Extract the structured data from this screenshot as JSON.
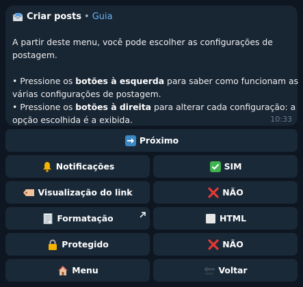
{
  "header": {
    "title": "Criar posts",
    "separator": "•",
    "subtitle": "Guia",
    "icon": "envelope-icon"
  },
  "message": {
    "line1": "A partir deste menu, você pode escolher as configurações de",
    "line2": "postagem.",
    "b1_prefix": "• Pressione os ",
    "b1_bold": "botões à esquerda",
    "b1_suffix": " para saber como funcionam as",
    "b1_line2": "várias configurações de postagem.",
    "b2_prefix": "• Pressione os ",
    "b2_bold": "botões à direita",
    "b2_suffix": " para alterar cada configuração: a",
    "b2_line2": "opção escolhida é a exibida.",
    "time": "10:33"
  },
  "buttons": {
    "next": "Próximo",
    "notifications": "Notificações",
    "notifications_value": "SIM",
    "link_preview": "Visualização do link",
    "link_preview_value": "NÃO",
    "formatting": "Formatação",
    "formatting_value": "HTML",
    "protected": "Protegido",
    "protected_value": "NÃO",
    "menu": "Menu",
    "back": "Voltar"
  },
  "colors": {
    "background": "#0e1621",
    "bubble": "#182533",
    "button": "#1a2938",
    "link": "#6ab3f3"
  }
}
